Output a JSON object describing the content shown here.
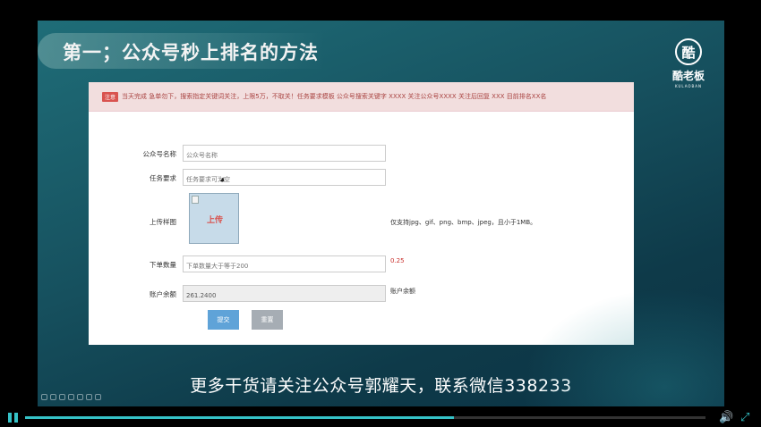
{
  "slide": {
    "title": "第一；公众号秒上排名的方法",
    "subtitle": "更多干货请关注公众号郭耀天，联系微信338233"
  },
  "logo": {
    "glyph": "酷",
    "name": "酷老板",
    "sub": "KULAOBAN"
  },
  "notice": {
    "badge": "注意",
    "text": "当天完成 急单勿下，搜索指定关键词关注，上限5万，不取关！任务要求模板 公众号搜索关键字 XXXX 关注公众号XXXX 关注后回复 XXX 目前排名XX名"
  },
  "form": {
    "account_name": {
      "label": "公众号名称",
      "placeholder": "公众号名称"
    },
    "task": {
      "label": "任务要求",
      "placeholder": "任务要求可为空"
    },
    "sample": {
      "label": "上传样图",
      "upload_text": "上传",
      "note": "仅支持jpg、gif、png、bmp、jpeg，且小于1MB。"
    },
    "quantity": {
      "label": "下单数量",
      "placeholder": "下单数量大于等于200",
      "price": "0.25"
    },
    "balance": {
      "label": "账户余额",
      "value": "261.2400",
      "note": "账户余额"
    },
    "submit_label": "提交",
    "reset_label": "重置"
  },
  "player": {
    "progress": 0.63,
    "accent": "#35c2c7",
    "icons": [
      "pause-icon",
      "volume-icon",
      "fullscreen-icon"
    ]
  }
}
